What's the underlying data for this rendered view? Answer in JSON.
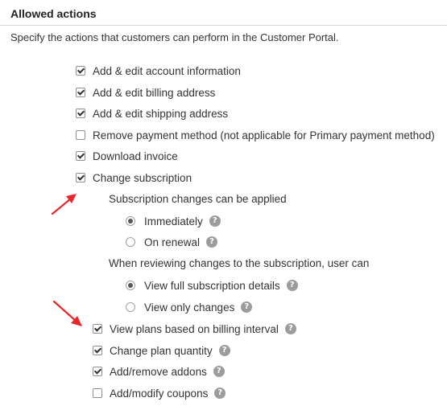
{
  "section": {
    "title": "Allowed actions",
    "description": "Specify the actions that customers can perform in the Customer Portal."
  },
  "actions": [
    {
      "label": "Add & edit account information",
      "checked": true
    },
    {
      "label": "Add & edit billing address",
      "checked": true
    },
    {
      "label": "Add & edit shipping address",
      "checked": true
    },
    {
      "label": "Remove payment method (not applicable for Primary payment method)",
      "checked": false
    },
    {
      "label": "Download invoice",
      "checked": true
    },
    {
      "label": "Change subscription",
      "checked": true
    }
  ],
  "subscription_changes": {
    "label": "Subscription changes can be applied",
    "options": [
      {
        "label": "Immediately",
        "selected": true
      },
      {
        "label": "On renewal",
        "selected": false
      }
    ]
  },
  "review_changes": {
    "label": "When reviewing changes to the subscription, user can",
    "options": [
      {
        "label": "View full subscription details",
        "selected": true
      },
      {
        "label": "View only changes",
        "selected": false
      }
    ]
  },
  "sub_actions": [
    {
      "label": "View plans based on billing interval",
      "checked": true
    },
    {
      "label": "Change plan quantity",
      "checked": true
    },
    {
      "label": "Add/remove addons",
      "checked": true
    },
    {
      "label": "Add/modify coupons",
      "checked": false
    }
  ],
  "help_icon_glyph": "?",
  "colors": {
    "arrow": "#e8262b",
    "help_icon": "#9c9c9c"
  }
}
